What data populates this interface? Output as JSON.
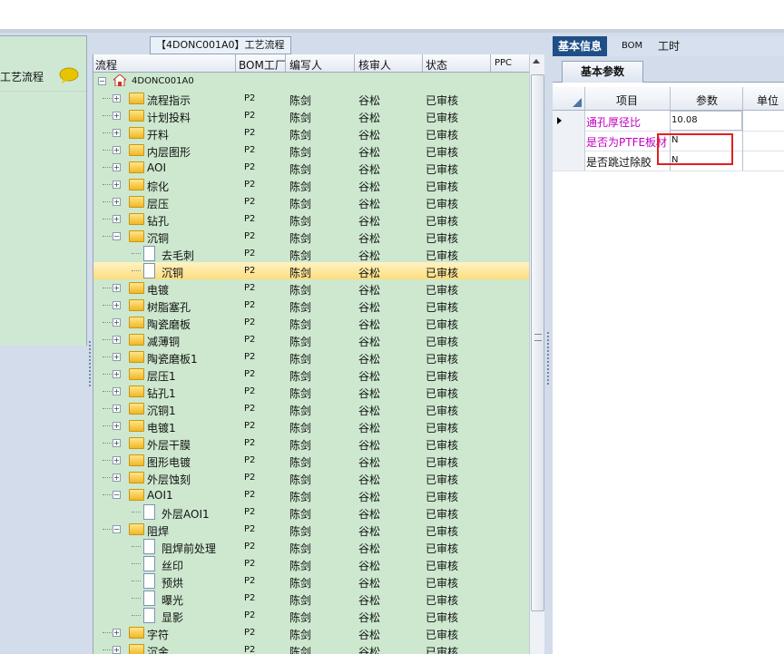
{
  "left_panel": {
    "title": "工艺流程"
  },
  "center_panel": {
    "tab_title": "【4DONC001A0】工艺流程",
    "columns": [
      "流程",
      "BOM工厂",
      "编写人",
      "核审人",
      "状态",
      "PPC"
    ],
    "root": "4DONC001A0",
    "rows": [
      {
        "level": 1,
        "type": "folder",
        "exp": "+",
        "name": "流程指示",
        "factory": "P2",
        "writer": "陈剑",
        "reviewer": "谷松",
        "status": "已审核"
      },
      {
        "level": 1,
        "type": "folder",
        "exp": "+",
        "name": "计划投料",
        "factory": "P2",
        "writer": "陈剑",
        "reviewer": "谷松",
        "status": "已审核"
      },
      {
        "level": 1,
        "type": "folder",
        "exp": "+",
        "name": "开料",
        "factory": "P2",
        "writer": "陈剑",
        "reviewer": "谷松",
        "status": "已审核"
      },
      {
        "level": 1,
        "type": "folder",
        "exp": "+",
        "name": "内层图形",
        "factory": "P2",
        "writer": "陈剑",
        "reviewer": "谷松",
        "status": "已审核"
      },
      {
        "level": 1,
        "type": "folder",
        "exp": "+",
        "name": "AOI",
        "factory": "P2",
        "writer": "陈剑",
        "reviewer": "谷松",
        "status": "已审核"
      },
      {
        "level": 1,
        "type": "folder",
        "exp": "+",
        "name": "棕化",
        "factory": "P2",
        "writer": "陈剑",
        "reviewer": "谷松",
        "status": "已审核"
      },
      {
        "level": 1,
        "type": "folder",
        "exp": "+",
        "name": "层压",
        "factory": "P2",
        "writer": "陈剑",
        "reviewer": "谷松",
        "status": "已审核"
      },
      {
        "level": 1,
        "type": "folder",
        "exp": "+",
        "name": "钻孔",
        "factory": "P2",
        "writer": "陈剑",
        "reviewer": "谷松",
        "status": "已审核"
      },
      {
        "level": 1,
        "type": "folder",
        "exp": "-",
        "name": "沉铜",
        "factory": "P2",
        "writer": "陈剑",
        "reviewer": "谷松",
        "status": "已审核"
      },
      {
        "level": 2,
        "type": "doc",
        "name": "去毛刺",
        "factory": "P2",
        "writer": "陈剑",
        "reviewer": "谷松",
        "status": "已审核"
      },
      {
        "level": 2,
        "type": "doc",
        "name": "沉铜",
        "factory": "P2",
        "writer": "陈剑",
        "reviewer": "谷松",
        "status": "已审核",
        "selected": true
      },
      {
        "level": 1,
        "type": "folder",
        "exp": "+",
        "name": "电镀",
        "factory": "P2",
        "writer": "陈剑",
        "reviewer": "谷松",
        "status": "已审核"
      },
      {
        "level": 1,
        "type": "folder",
        "exp": "+",
        "name": "树脂塞孔",
        "factory": "P2",
        "writer": "陈剑",
        "reviewer": "谷松",
        "status": "已审核"
      },
      {
        "level": 1,
        "type": "folder",
        "exp": "+",
        "name": "陶瓷磨板",
        "factory": "P2",
        "writer": "陈剑",
        "reviewer": "谷松",
        "status": "已审核"
      },
      {
        "level": 1,
        "type": "folder",
        "exp": "+",
        "name": "减薄铜",
        "factory": "P2",
        "writer": "陈剑",
        "reviewer": "谷松",
        "status": "已审核"
      },
      {
        "level": 1,
        "type": "folder",
        "exp": "+",
        "name": "陶瓷磨板1",
        "factory": "P2",
        "writer": "陈剑",
        "reviewer": "谷松",
        "status": "已审核"
      },
      {
        "level": 1,
        "type": "folder",
        "exp": "+",
        "name": "层压1",
        "factory": "P2",
        "writer": "陈剑",
        "reviewer": "谷松",
        "status": "已审核"
      },
      {
        "level": 1,
        "type": "folder",
        "exp": "+",
        "name": "钻孔1",
        "factory": "P2",
        "writer": "陈剑",
        "reviewer": "谷松",
        "status": "已审核"
      },
      {
        "level": 1,
        "type": "folder",
        "exp": "+",
        "name": "沉铜1",
        "factory": "P2",
        "writer": "陈剑",
        "reviewer": "谷松",
        "status": "已审核"
      },
      {
        "level": 1,
        "type": "folder",
        "exp": "+",
        "name": "电镀1",
        "factory": "P2",
        "writer": "陈剑",
        "reviewer": "谷松",
        "status": "已审核"
      },
      {
        "level": 1,
        "type": "folder",
        "exp": "+",
        "name": "外层干膜",
        "factory": "P2",
        "writer": "陈剑",
        "reviewer": "谷松",
        "status": "已审核"
      },
      {
        "level": 1,
        "type": "folder",
        "exp": "+",
        "name": "图形电镀",
        "factory": "P2",
        "writer": "陈剑",
        "reviewer": "谷松",
        "status": "已审核"
      },
      {
        "level": 1,
        "type": "folder",
        "exp": "+",
        "name": "外层蚀刻",
        "factory": "P2",
        "writer": "陈剑",
        "reviewer": "谷松",
        "status": "已审核"
      },
      {
        "level": 1,
        "type": "folder",
        "exp": "-",
        "name": "AOI1",
        "factory": "P2",
        "writer": "陈剑",
        "reviewer": "谷松",
        "status": "已审核"
      },
      {
        "level": 2,
        "type": "doc",
        "name": "外层AOI1",
        "factory": "P2",
        "writer": "陈剑",
        "reviewer": "谷松",
        "status": "已审核"
      },
      {
        "level": 1,
        "type": "folder",
        "exp": "-",
        "name": "阻焊",
        "factory": "P2",
        "writer": "陈剑",
        "reviewer": "谷松",
        "status": "已审核"
      },
      {
        "level": 2,
        "type": "doc",
        "name": "阻焊前处理",
        "factory": "P2",
        "writer": "陈剑",
        "reviewer": "谷松",
        "status": "已审核"
      },
      {
        "level": 2,
        "type": "doc",
        "name": "丝印",
        "factory": "P2",
        "writer": "陈剑",
        "reviewer": "谷松",
        "status": "已审核"
      },
      {
        "level": 2,
        "type": "doc",
        "name": "预烘",
        "factory": "P2",
        "writer": "陈剑",
        "reviewer": "谷松",
        "status": "已审核"
      },
      {
        "level": 2,
        "type": "doc",
        "name": "曝光",
        "factory": "P2",
        "writer": "陈剑",
        "reviewer": "谷松",
        "status": "已审核"
      },
      {
        "level": 2,
        "type": "doc",
        "name": "显影",
        "factory": "P2",
        "writer": "陈剑",
        "reviewer": "谷松",
        "status": "已审核"
      },
      {
        "level": 1,
        "type": "folder",
        "exp": "+",
        "name": "字符",
        "factory": "P2",
        "writer": "陈剑",
        "reviewer": "谷松",
        "status": "已审核"
      },
      {
        "level": 1,
        "type": "folder",
        "exp": "+",
        "name": "沉金",
        "factory": "P2",
        "writer": "陈剑",
        "reviewer": "谷松",
        "status": "已审核"
      }
    ]
  },
  "right_panel": {
    "tabs": [
      "基本信息",
      "BOM",
      "工时"
    ],
    "subtab": "基本参数",
    "columns": [
      "项目",
      "参数",
      "单位"
    ],
    "params": [
      {
        "item": "通孔厚径比",
        "value": "10.08",
        "highlight": true,
        "current": true
      },
      {
        "item": "是否为PTFE板材",
        "value": "N",
        "highlight": true
      },
      {
        "item": "是否跳过除胶",
        "value": "N",
        "highlight": false
      }
    ]
  },
  "colors": {
    "tree_bg": "#cde8cf",
    "selected_row": "#fddd7c",
    "accent_tab": "#1f4f87",
    "param_highlight": "#c000c0",
    "callout": "#e02020"
  }
}
